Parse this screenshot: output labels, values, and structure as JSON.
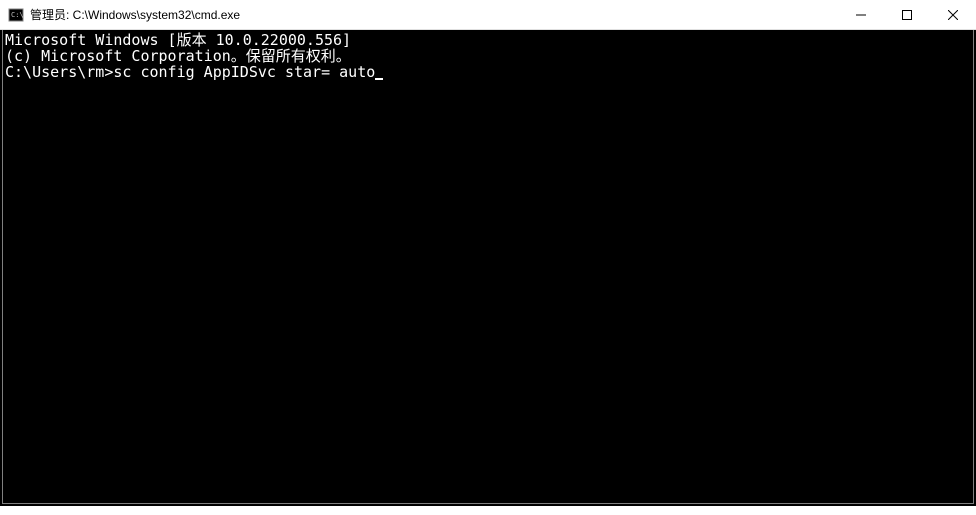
{
  "titlebar": {
    "title": "管理员: C:\\Windows\\system32\\cmd.exe"
  },
  "terminal": {
    "line1": "Microsoft Windows [版本 10.0.22000.556]",
    "line2": "(c) Microsoft Corporation。保留所有权利。",
    "blank": "",
    "prompt": "C:\\Users\\rm>",
    "command": "sc config AppIDSvc star= auto"
  }
}
